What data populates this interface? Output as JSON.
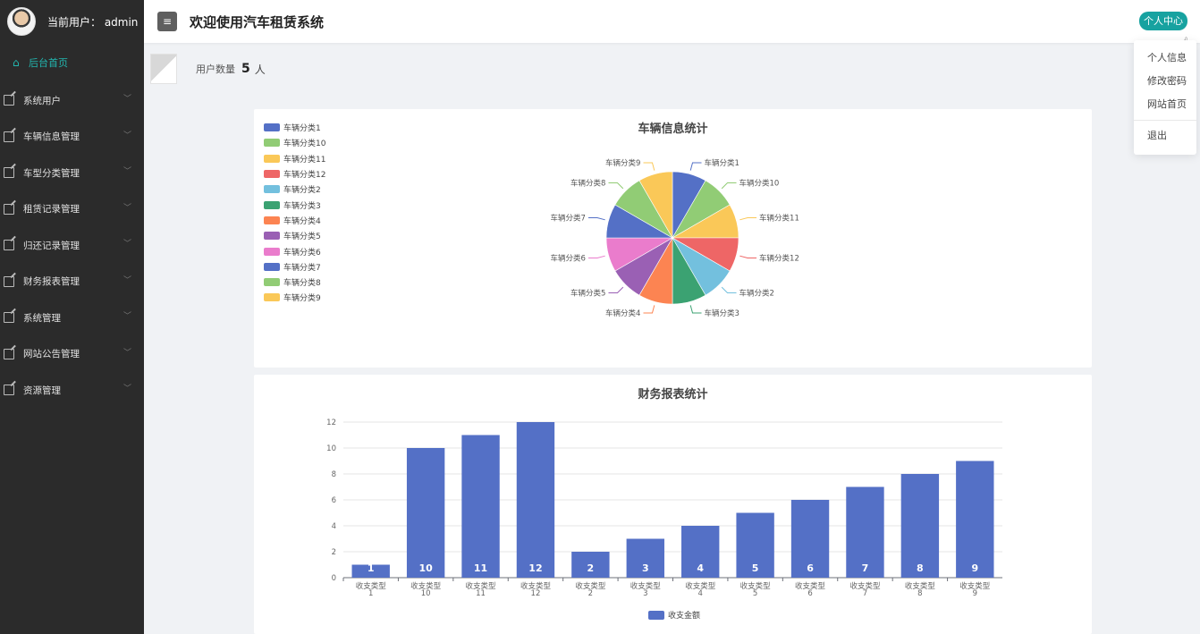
{
  "sidebar": {
    "user_label": "当前用户： admin",
    "home_label": "后台首页",
    "items": [
      {
        "label": "系统用户"
      },
      {
        "label": "车辆信息管理"
      },
      {
        "label": "车型分类管理"
      },
      {
        "label": "租赁记录管理"
      },
      {
        "label": "归还记录管理"
      },
      {
        "label": "财务报表管理"
      },
      {
        "label": "系统管理"
      },
      {
        "label": "网站公告管理"
      },
      {
        "label": "资源管理"
      }
    ]
  },
  "header": {
    "menu_icon": "≡",
    "title": "欢迎使用汽车租赁系统",
    "user_center_label": "个人中心"
  },
  "dropdown": {
    "items": [
      "个人信息",
      "修改密码",
      "网站首页"
    ],
    "logout_label": "退出"
  },
  "stats": {
    "label": "用户数量",
    "value": "5",
    "unit": "人"
  },
  "colors": {
    "accent": "#17a2a0",
    "sidebar_bg": "#2b2b2b",
    "bar": "#5470c6"
  },
  "icons": {
    "home": "house-icon",
    "menu": "edit-icon",
    "toggle": "hamburger-icon"
  },
  "chart_data": [
    {
      "type": "pie",
      "title": "车辆信息统计",
      "legend_position": "top-left",
      "labels": [
        "车辆分类1",
        "车辆分类10",
        "车辆分类11",
        "车辆分类12",
        "车辆分类2",
        "车辆分类3",
        "车辆分类4",
        "车辆分类5",
        "车辆分类6",
        "车辆分类7",
        "车辆分类8",
        "车辆分类9"
      ],
      "values": [
        1,
        1,
        1,
        1,
        1,
        1,
        1,
        1,
        1,
        1,
        1,
        1
      ],
      "colors": [
        "#5470c6",
        "#91cc75",
        "#fac858",
        "#ee6666",
        "#73c0de",
        "#3ba272",
        "#fc8452",
        "#9a60b4",
        "#ea7ccc",
        "#5470c6",
        "#91cc75",
        "#fac858"
      ]
    },
    {
      "type": "bar",
      "title": "财务报表统计",
      "categories": [
        "收支类型1",
        "收支类型10",
        "收支类型11",
        "收支类型12",
        "收支类型2",
        "收支类型3",
        "收支类型4",
        "收支类型5",
        "收支类型6",
        "收支类型7",
        "收支类型8",
        "收支类型9"
      ],
      "series": [
        {
          "name": "收支金额",
          "values": [
            1,
            10,
            11,
            12,
            2,
            3,
            4,
            5,
            6,
            7,
            8,
            9
          ]
        }
      ],
      "ylim": [
        0,
        12
      ],
      "yticks": [
        0,
        2,
        4,
        6,
        8,
        10,
        12
      ],
      "grid": true,
      "legend_position": "bottom-center"
    }
  ]
}
